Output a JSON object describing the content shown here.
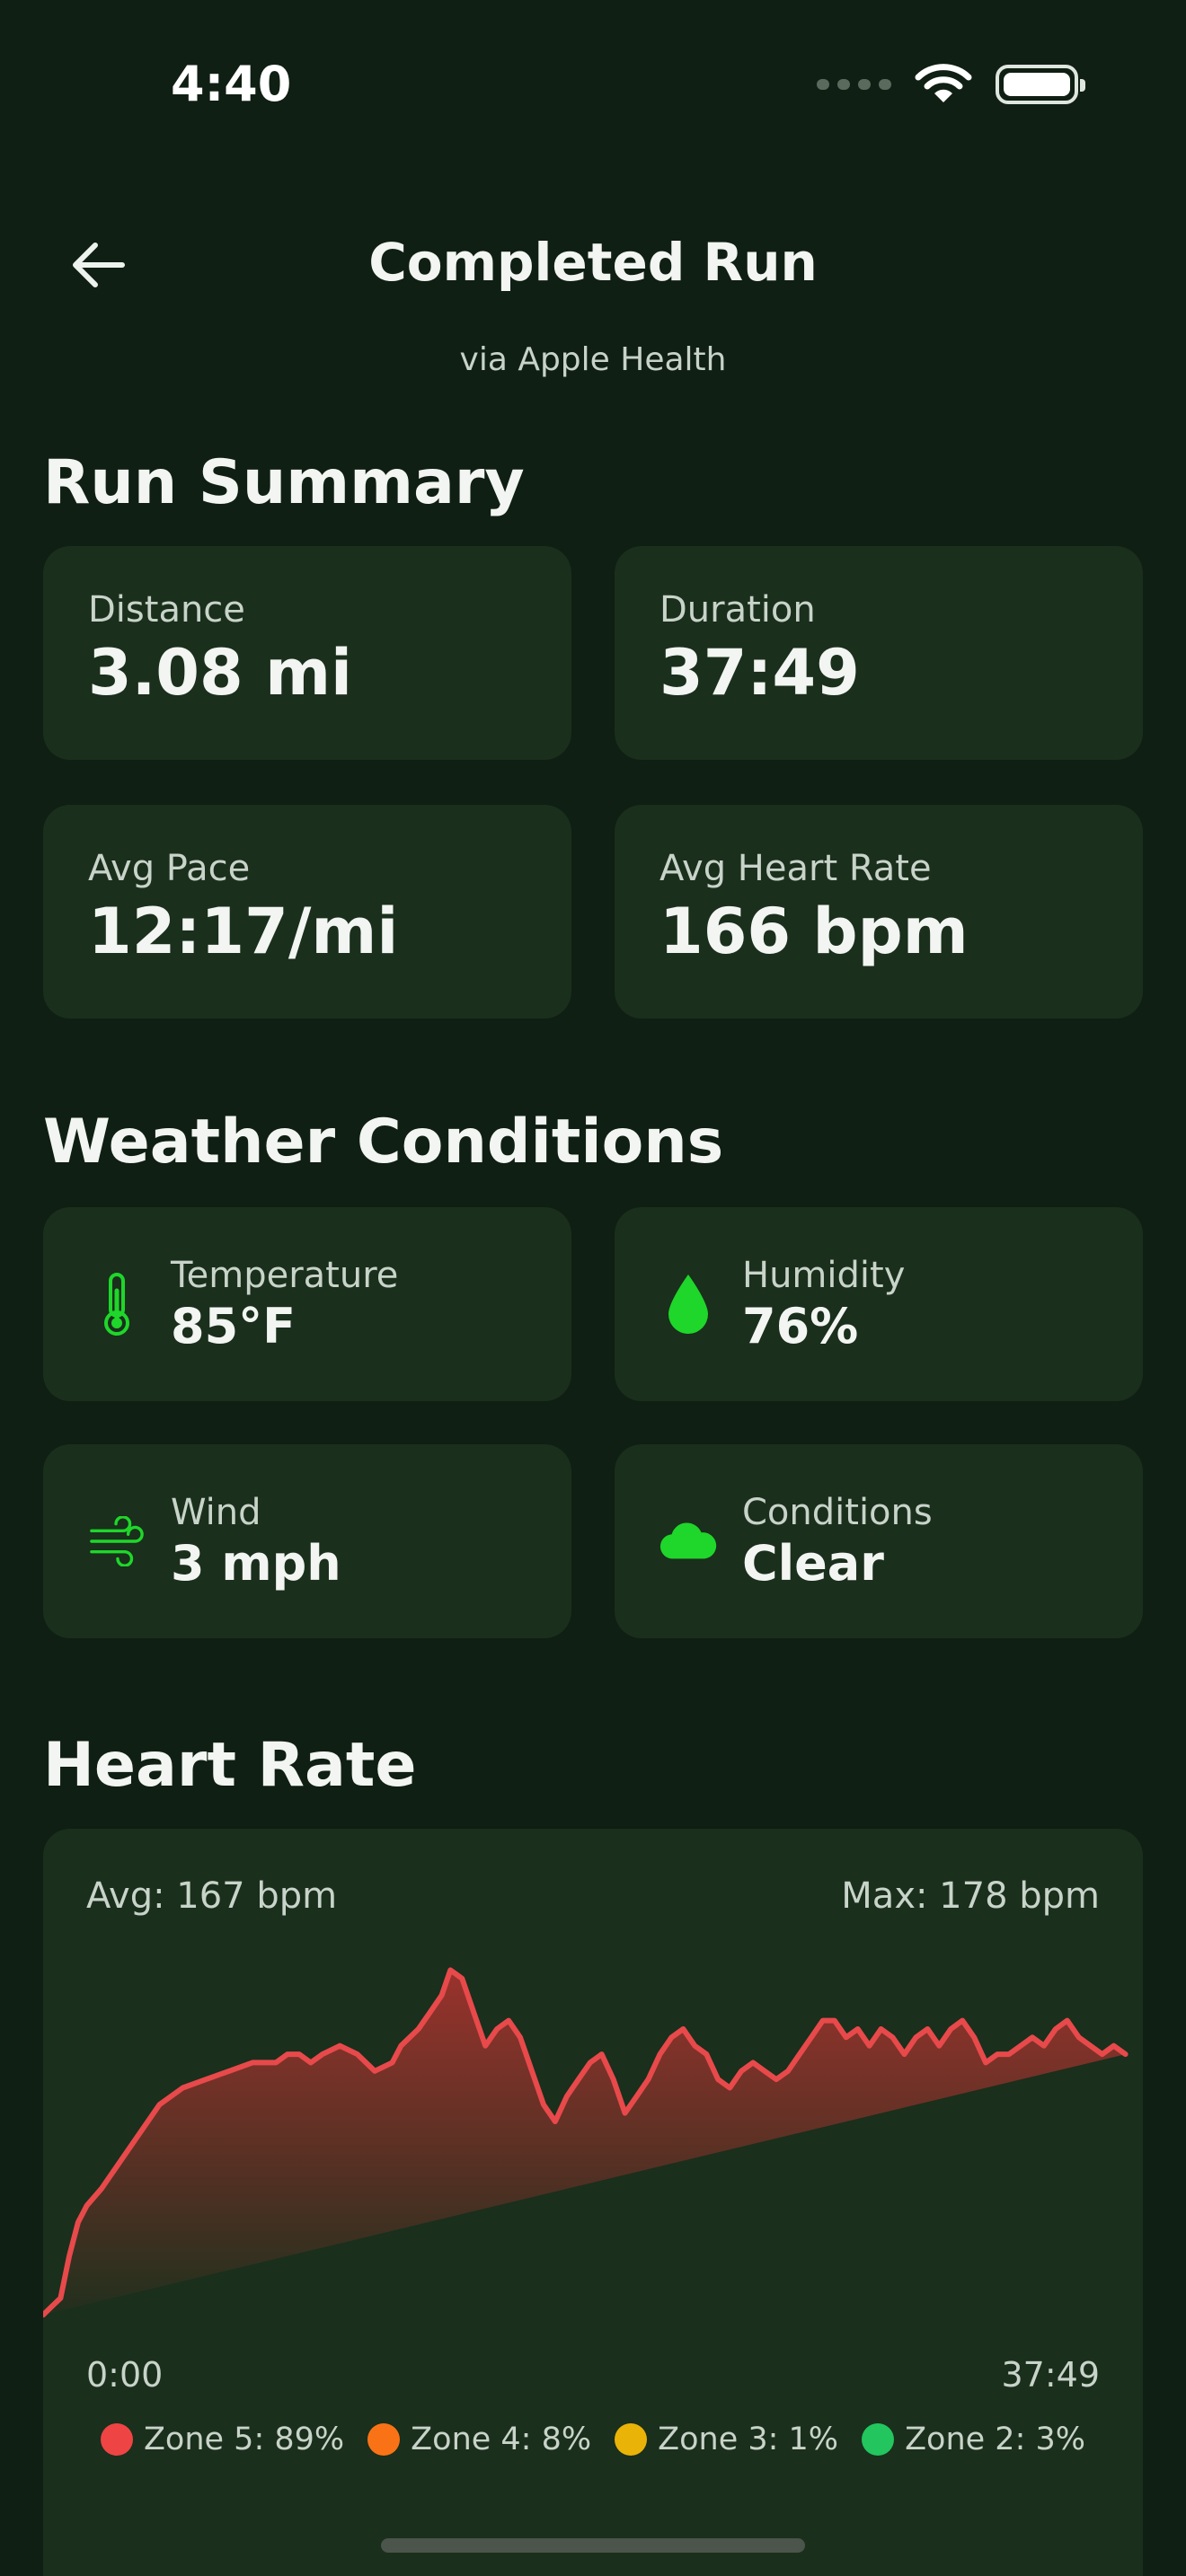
{
  "status_bar": {
    "time": "4:40"
  },
  "header": {
    "title": "Completed Run",
    "subtitle": "via Apple Health",
    "back_icon": "arrow-left-icon"
  },
  "run_summary": {
    "title": "Run Summary",
    "stats": [
      {
        "label": "Distance",
        "value": "3.08 mi"
      },
      {
        "label": "Duration",
        "value": "37:49"
      },
      {
        "label": "Avg Pace",
        "value": "12:17/mi"
      },
      {
        "label": "Avg Heart Rate",
        "value": "166 bpm"
      }
    ]
  },
  "weather": {
    "title": "Weather Conditions",
    "items": [
      {
        "icon": "thermometer-icon",
        "label": "Temperature",
        "value": "85°F"
      },
      {
        "icon": "droplet-icon",
        "label": "Humidity",
        "value": "76%"
      },
      {
        "icon": "wind-icon",
        "label": "Wind",
        "value": "3 mph"
      },
      {
        "icon": "cloud-icon",
        "label": "Conditions",
        "value": "Clear"
      }
    ],
    "accent_color": "#1fd62a"
  },
  "heart_rate": {
    "title": "Heart Rate",
    "avg_label": "Avg: 167 bpm",
    "max_label": "Max: 178 bpm",
    "start_label": "0:00",
    "end_label": "37:49",
    "line_color": "#e8494b",
    "zones": [
      {
        "label": "Zone 5: 89%",
        "color": "#ef4444"
      },
      {
        "label": "Zone 4: 8%",
        "color": "#f97316"
      },
      {
        "label": "Zone 3: 1%",
        "color": "#eab308"
      },
      {
        "label": "Zone 2: 3%",
        "color": "#22c55e"
      }
    ]
  },
  "chart_data": {
    "type": "area",
    "xlabel": "",
    "ylabel": "",
    "x_range_minutes": [
      0,
      37.8
    ],
    "ylim": [
      135,
      182
    ],
    "x": [
      0,
      0.3,
      0.6,
      0.9,
      1.2,
      1.5,
      2,
      2.6,
      3.2,
      4,
      4.8,
      5.6,
      6.4,
      7.2,
      7.6,
      8,
      8.4,
      8.8,
      9.2,
      9.6,
      10.2,
      10.8,
      11.4,
      12,
      12.3,
      12.6,
      12.9,
      13.3,
      13.7,
      14,
      14.4,
      14.8,
      15.2,
      15.6,
      16,
      16.4,
      16.8,
      17.2,
      17.6,
      18,
      18.4,
      18.8,
      19.2,
      19.6,
      20,
      20.4,
      20.8,
      21.2,
      21.6,
      22,
      22.4,
      22.8,
      23.2,
      23.6,
      24,
      24.4,
      24.8,
      25.2,
      25.6,
      26,
      26.4,
      26.8,
      27.2,
      27.6,
      28,
      28.4,
      28.8,
      29.2,
      29.6,
      30,
      30.4,
      30.8,
      31.2,
      31.6,
      32,
      32.4,
      32.8,
      33.2,
      33.6,
      34,
      34.4,
      34.8,
      35.2,
      35.6,
      36,
      36.4,
      36.8,
      37.2,
      37.8
    ],
    "values": [
      137,
      138,
      139,
      144,
      148,
      150,
      152,
      155,
      158,
      162,
      164,
      165,
      166,
      167,
      167,
      167,
      168,
      168,
      167,
      168,
      169,
      168,
      166,
      167,
      169,
      170,
      171,
      173,
      175,
      178,
      177,
      173,
      169,
      171,
      172,
      170,
      166,
      162,
      160,
      163,
      165,
      167,
      168,
      165,
      161,
      163,
      165,
      168,
      170,
      171,
      169,
      168,
      165,
      164,
      166,
      167,
      166,
      165,
      166,
      168,
      170,
      172,
      172,
      170,
      171,
      169,
      171,
      170,
      168,
      170,
      171,
      169,
      171,
      172,
      170,
      167,
      168,
      168,
      169,
      170,
      169,
      171,
      172,
      170,
      169,
      168,
      169,
      168
    ]
  }
}
